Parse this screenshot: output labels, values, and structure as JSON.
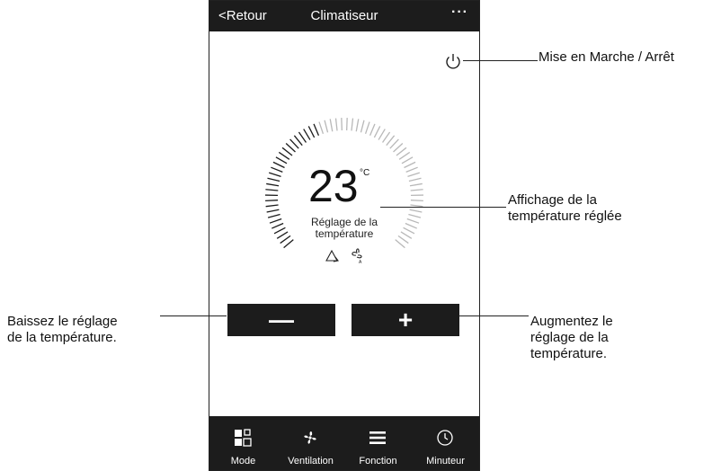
{
  "header": {
    "back_label": "<Retour",
    "title": "Climatiseur",
    "more_label": "···"
  },
  "thermostat": {
    "temperature": "23",
    "unit": "°C",
    "caption_line1": "Réglage de la",
    "caption_line2": "température",
    "mode_icons": [
      "recycle-icon",
      "fan-auto-icon"
    ]
  },
  "controls": {
    "decrease_label": "—",
    "increase_label": "+"
  },
  "bottom_nav": [
    {
      "label": "Mode",
      "icon": "mode-icon"
    },
    {
      "label": "Ventilation",
      "icon": "fan-icon"
    },
    {
      "label": "Fonction",
      "icon": "menu-icon"
    },
    {
      "label": "Minuteur",
      "icon": "clock-icon"
    }
  ],
  "annotations": {
    "power": "Mise en Marche / Arrêt",
    "display_line1": "Affichage de la",
    "display_line2": "température réglée",
    "decrease_line1": "Baissez le réglage",
    "decrease_line2": "de la température.",
    "increase_line1": "Augmentez le",
    "increase_line2": "réglage de la",
    "increase_line3": "température."
  },
  "colors": {
    "bar_background": "#1c1c1c",
    "dial_active": "#1c1c1c",
    "dial_inactive": "#b8b8b8"
  }
}
